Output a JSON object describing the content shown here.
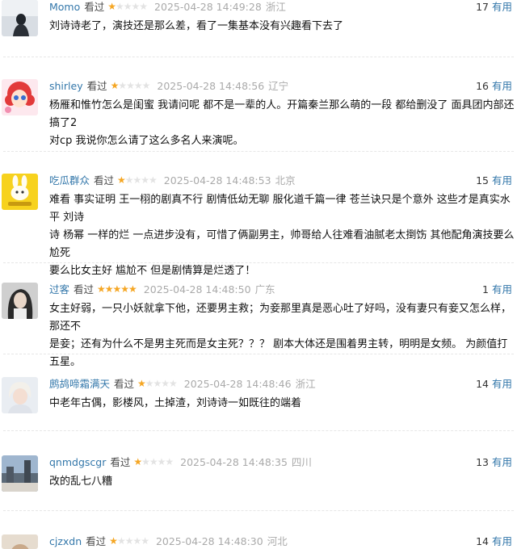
{
  "colors": {
    "username": "#3377aa",
    "star_filled": "#f5a623",
    "star_empty": "#e3e3e3",
    "meta_gray": "#aaaaaa"
  },
  "comments": [
    {
      "user": "Momo",
      "status": "看过",
      "stars": 1,
      "time": "2025-04-28 14:49:28",
      "location": "浙江",
      "votes": "17",
      "vote_label": "有用",
      "text": "刘诗诗老了，演技还是那么差，看了一集基本没有兴趣看下去了"
    },
    {
      "user": "shirley",
      "status": "看过",
      "stars": 1,
      "time": "2025-04-28 14:48:56",
      "location": "辽宁",
      "votes": "16",
      "vote_label": "有用",
      "text": "杨雁和惟竹怎么是闺蜜 我请问呢 都不是一辈的人。开篇秦兰那么萌的一段 都给删没了 面具团内部还搞了2\n对cp 我说你怎么请了这么多名人来演呢。"
    },
    {
      "user": "吃瓜群众",
      "status": "看过",
      "stars": 1,
      "time": "2025-04-28 14:48:53",
      "location": "北京",
      "votes": "15",
      "vote_label": "有用",
      "text": "难看 事实证明 王一栩的剧真不行 剧情低幼无聊 服化道千篇一律 苍兰诀只是个意外 这些才是真实水平 刘诗\n诗 杨幂 一样的烂 一点进步没有，可惜了俩副男主，帅哥给人往难看油腻老太捯饬 其他配角演技要么尬死\n要么比女主好 尴尬不 但是剧情算是烂透了！"
    },
    {
      "user": "过客",
      "status": "看过",
      "stars": 5,
      "time": "2025-04-28 14:48:50",
      "location": "广东",
      "votes": "1",
      "vote_label": "有用",
      "text": "女主好弱，一只小妖就拿下他，还要男主救；为妾那里真是恶心吐了好吗，没有妻只有妾又怎么样，那还不\n是妾；还有为什么不是男主死而是女主死？？？ 剧本大体还是围着男主转，明明是女频。 为颜值打五星。"
    },
    {
      "user": "鹧鸪啼霜满天",
      "status": "看过",
      "stars": 1,
      "time": "2025-04-28 14:48:46",
      "location": "浙江",
      "votes": "14",
      "vote_label": "有用",
      "text": "中老年古偶，影楼风，土掉渣，刘诗诗一如既往的端着"
    },
    {
      "user": "qnmdgscgr",
      "status": "看过",
      "stars": 1,
      "time": "2025-04-28 14:48:35",
      "location": "四川",
      "votes": "13",
      "vote_label": "有用",
      "text": "改的乱七八糟"
    },
    {
      "user": "cjzxdn",
      "status": "看过",
      "stars": 1,
      "time": "2025-04-28 14:48:30",
      "location": "河北",
      "votes": "14",
      "vote_label": "有用",
      "text": ""
    }
  ]
}
